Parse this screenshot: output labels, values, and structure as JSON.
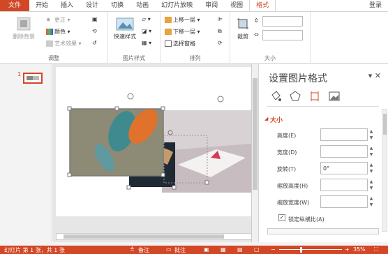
{
  "tabs": {
    "file": "文件",
    "home": "开始",
    "insert": "插入",
    "design": "设计",
    "transitions": "切换",
    "animations": "动画",
    "slideshow": "幻灯片放映",
    "review": "审阅",
    "view": "视图",
    "format": "格式",
    "login": "登录"
  },
  "ribbon": {
    "remove_bg": "删除背景",
    "corrections": "更正",
    "color": "颜色",
    "artistic": "艺术效果",
    "adjust_label": "调整",
    "quick_styles": "快速样式",
    "picture_styles_label": "图片样式",
    "bring_forward": "上移一层",
    "send_backward": "下移一层",
    "selection_pane": "选择窗格",
    "arrange_label": "排列",
    "crop": "裁剪",
    "size_label": "大小"
  },
  "slides": {
    "number": "1"
  },
  "panel": {
    "title": "设置图片格式",
    "section": "大小",
    "height_label": "高度(E)",
    "width_label": "宽度(D)",
    "rotation_label": "旋转(T)",
    "rotation_value": "0°",
    "scale_height_label": "缩放高度(H)",
    "scale_width_label": "缩放宽度(W)",
    "lock_ratio_label": "锁定纵横比(A)"
  },
  "status": {
    "slide_info": "幻灯片 第 1 张，共 1 张",
    "notes": "备注",
    "comments": "批注",
    "zoom": "35%"
  },
  "colors": {
    "accent": "#d24726"
  }
}
